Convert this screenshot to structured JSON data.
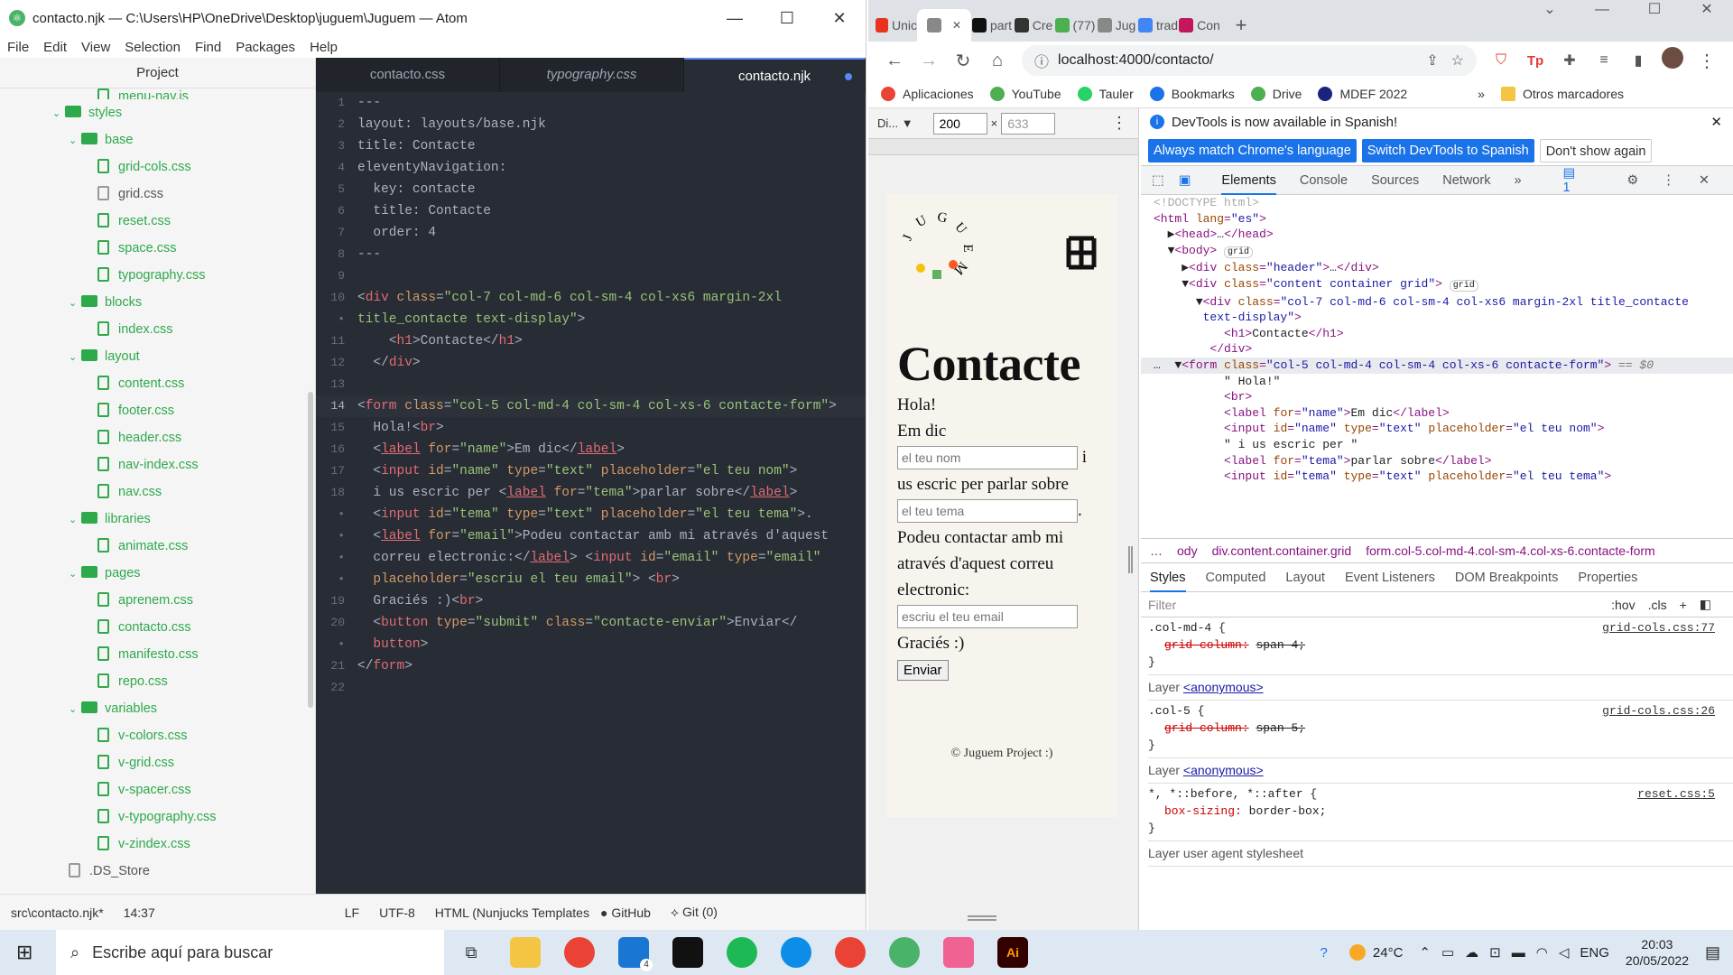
{
  "atom": {
    "title": "contacto.njk — C:\\Users\\HP\\OneDrive\\Desktop\\juguem\\Juguem — Atom",
    "menu": [
      "File",
      "Edit",
      "View",
      "Selection",
      "Find",
      "Packages",
      "Help"
    ],
    "tree_title": "Project",
    "tree": [
      {
        "type": "file",
        "label": "menu-nav.js",
        "depth": 3,
        "cut": true
      },
      {
        "type": "folder",
        "label": "styles",
        "depth": 1
      },
      {
        "type": "folder",
        "label": "base",
        "depth": 2
      },
      {
        "type": "file",
        "label": "grid-cols.css",
        "depth": 3
      },
      {
        "type": "file",
        "label": "grid.css",
        "depth": 3,
        "gray": true
      },
      {
        "type": "file",
        "label": "reset.css",
        "depth": 3
      },
      {
        "type": "file",
        "label": "space.css",
        "depth": 3
      },
      {
        "type": "file",
        "label": "typography.css",
        "depth": 3
      },
      {
        "type": "folder",
        "label": "blocks",
        "depth": 2
      },
      {
        "type": "file",
        "label": "index.css",
        "depth": 3
      },
      {
        "type": "folder",
        "label": "layout",
        "depth": 2
      },
      {
        "type": "file",
        "label": "content.css",
        "depth": 3
      },
      {
        "type": "file",
        "label": "footer.css",
        "depth": 3
      },
      {
        "type": "file",
        "label": "header.css",
        "depth": 3
      },
      {
        "type": "file",
        "label": "nav-index.css",
        "depth": 3
      },
      {
        "type": "file",
        "label": "nav.css",
        "depth": 3
      },
      {
        "type": "folder",
        "label": "libraries",
        "depth": 2
      },
      {
        "type": "file",
        "label": "animate.css",
        "depth": 3
      },
      {
        "type": "folder",
        "label": "pages",
        "depth": 2
      },
      {
        "type": "file",
        "label": "aprenem.css",
        "depth": 3
      },
      {
        "type": "file",
        "label": "contacto.css",
        "depth": 3
      },
      {
        "type": "file",
        "label": "manifesto.css",
        "depth": 3
      },
      {
        "type": "file",
        "label": "repo.css",
        "depth": 3
      },
      {
        "type": "folder",
        "label": "variables",
        "depth": 2
      },
      {
        "type": "file",
        "label": "v-colors.css",
        "depth": 3
      },
      {
        "type": "file",
        "label": "v-grid.css",
        "depth": 3
      },
      {
        "type": "file",
        "label": "v-spacer.css",
        "depth": 3
      },
      {
        "type": "file",
        "label": "v-typography.css",
        "depth": 3
      },
      {
        "type": "file",
        "label": "v-zindex.css",
        "depth": 3
      },
      {
        "type": "file",
        "label": ".DS_Store",
        "depth": 2,
        "gray": true
      }
    ],
    "tabs": [
      {
        "label": "contacto.css"
      },
      {
        "label": "typography.css",
        "italic": true
      },
      {
        "label": "contacto.njk",
        "active": true,
        "modified": true
      }
    ],
    "code": [
      {
        "n": "1",
        "h": "<span class='p'>---</span>"
      },
      {
        "n": "2",
        "h": "<span class='p'>layout: layouts/base.njk</span>"
      },
      {
        "n": "3",
        "h": "<span class='p'>title: Contacte</span>"
      },
      {
        "n": "4",
        "h": "<span class='p'>eleventyNavigation:</span>"
      },
      {
        "n": "5",
        "h": "<span class='p'>  key: contacte</span>"
      },
      {
        "n": "6",
        "h": "<span class='p'>  title: Contacte</span>"
      },
      {
        "n": "7",
        "h": "<span class='p'>  order: 4</span>"
      },
      {
        "n": "8",
        "h": "<span class='p'>---</span>"
      },
      {
        "n": "9",
        "h": ""
      },
      {
        "n": "10",
        "h": "<span class='p'>&lt;</span><span class='t'>div</span> <span class='a'>class</span>=<span class='s'>\"col-7 col-md-6 col-sm-4 col-xs6 margin-2xl</span>"
      },
      {
        "n": "•",
        "h": "<span class='s'>title_contacte text-display\"</span><span class='p'>&gt;</span>"
      },
      {
        "n": "11",
        "h": "    <span class='p'>&lt;</span><span class='t'>h1</span><span class='p'>&gt;Contacte&lt;/</span><span class='t'>h1</span><span class='p'>&gt;</span>"
      },
      {
        "n": "12",
        "h": "  <span class='p'>&lt;/</span><span class='t'>div</span><span class='p'>&gt;</span>"
      },
      {
        "n": "13",
        "h": ""
      },
      {
        "n": "14",
        "h": "<span class='p'>&lt;</span><span class='t'>form</span> <span class='a'>class</span>=<span class='s'>\"col-5 col-md-4 col-sm-4 col-xs-6 contacte-form\"</span><span class='p'>&gt;</span>",
        "cur": true
      },
      {
        "n": "15",
        "h": "  <span class='p'>Hola!&lt;</span><span class='t'>br</span><span class='p'>&gt;</span>"
      },
      {
        "n": "16",
        "h": "  <span class='p'>&lt;</span><span class='t'><u>label</u></span> <span class='a'>for</span>=<span class='s'>\"name\"</span><span class='p'>&gt;Em dic&lt;/</span><span class='t'><u>label</u></span><span class='p'>&gt;</span>"
      },
      {
        "n": "17",
        "h": "  <span class='p'>&lt;</span><span class='t'>input</span> <span class='a'>id</span>=<span class='s'>\"name\"</span> <span class='a'>type</span>=<span class='s'>\"text\"</span> <span class='a'>placeholder</span>=<span class='s'>\"el teu nom\"</span><span class='p'>&gt;</span>"
      },
      {
        "n": "18",
        "h": "  <span class='p'>i us escric per &lt;</span><span class='t'><u>label</u></span> <span class='a'>for</span>=<span class='s'>\"tema\"</span><span class='p'>&gt;parlar sobre&lt;/</span><span class='t'><u>label</u></span><span class='p'>&gt;</span>"
      },
      {
        "n": "•",
        "h": "  <span class='p'>&lt;</span><span class='t'>input</span> <span class='a'>id</span>=<span class='s'>\"tema\"</span> <span class='a'>type</span>=<span class='s'>\"text\"</span> <span class='a'>placeholder</span>=<span class='s'>\"el teu tema\"</span><span class='p'>&gt;.</span>"
      },
      {
        "n": "•",
        "h": "  <span class='p'>&lt;</span><span class='t'><u>label</u></span> <span class='a'>for</span>=<span class='s'>\"email\"</span><span class='p'>&gt;Podeu contactar amb mi através d'aquest</span>"
      },
      {
        "n": "•",
        "h": "  <span class='p'>correu electronic:&lt;/</span><span class='t'><u>label</u></span><span class='p'>&gt; &lt;</span><span class='t'>input</span> <span class='a'>id</span>=<span class='s'>\"email\"</span> <span class='a'>type</span>=<span class='s'>\"email\"</span>"
      },
      {
        "n": "•",
        "h": "  <span class='a'>placeholder</span>=<span class='s'>\"escriu el teu email\"</span><span class='p'>&gt; &lt;</span><span class='t'>br</span><span class='p'>&gt;</span>"
      },
      {
        "n": "19",
        "h": "  <span class='p'>Graciés :)&lt;</span><span class='t'>br</span><span class='p'>&gt;</span>"
      },
      {
        "n": "20",
        "h": "  <span class='p'>&lt;</span><span class='t'>button</span> <span class='a'>type</span>=<span class='s'>\"submit\"</span> <span class='a'>class</span>=<span class='s'>\"contacte-enviar\"</span><span class='p'>&gt;Enviar&lt;/</span>"
      },
      {
        "n": "•",
        "h": "  <span class='t'>button</span><span class='p'>&gt;</span>"
      },
      {
        "n": "21",
        "h": "<span class='p'>&lt;/</span><span class='t'>form</span><span class='p'>&gt;</span>"
      },
      {
        "n": "22",
        "h": ""
      }
    ],
    "status": {
      "path": "src\\contacto.njk*",
      "pos": "14:37",
      "eol": "LF",
      "enc": "UTF-8",
      "grammar": "HTML (Nunjucks Templates",
      "github": "GitHub",
      "git": "Git (0)"
    }
  },
  "chrome": {
    "tabs": [
      {
        "label": "Unic",
        "color": "#e8331f"
      },
      {
        "label": "",
        "color": "#888",
        "active": true
      },
      {
        "label": "part",
        "color": "#111"
      },
      {
        "label": "Cre",
        "color": "#333"
      },
      {
        "label": "(77)",
        "color": "#4caf50"
      },
      {
        "label": "Jug",
        "color": "#888"
      },
      {
        "label": "trad",
        "color": "#4285f4"
      },
      {
        "label": "Con",
        "color": "#c2185b"
      }
    ],
    "url": "localhost:4000/contacto/",
    "bookmarks": [
      {
        "label": "Aplicaciones",
        "color": "#ea4335"
      },
      {
        "label": "YouTube",
        "color": "#4caf50"
      },
      {
        "label": "Tauler",
        "color": "#25d366"
      },
      {
        "label": "Bookmarks",
        "color": "#1a73e8"
      },
      {
        "label": "Drive",
        "color": "#4caf50"
      },
      {
        "label": "MDEF 2022",
        "color": "#1a237e"
      }
    ],
    "other_bookmarks": "Otros marcadores",
    "device": {
      "label": "Di...",
      "width": "200",
      "height": "633"
    },
    "page": {
      "logo_text": "JUGUEM",
      "title": "Contacte",
      "hola": "Hola!",
      "emdic": "Em dic",
      "name_ph": "el teu nom",
      "i": "i",
      "us_escric": "us escric per parlar sobre",
      "tema_ph": "el teu tema",
      "period": ".",
      "contact_text": "Podeu contactar amb mi através d'aquest correu electronic:",
      "email_ph": "escriu el teu email",
      "gracies": "Graciés :)",
      "send": "Enviar",
      "footer": "© Juguem Project :)"
    },
    "devtools": {
      "notice": "DevTools is now available in Spanish!",
      "btn1": "Always match Chrome's language",
      "btn2": "Switch DevTools to Spanish",
      "btn3": "Don't show again",
      "tabs": [
        "Elements",
        "Console",
        "Sources",
        "Network"
      ],
      "badge": "1",
      "dom": [
        "<span class='cm'>&lt;!DOCTYPE html&gt;</span>",
        "<span class='tg'>&lt;html</span> <span class='at'>lang</span>=<span class='av'>\"es\"</span><span class='tg'>&gt;</span>",
        "  <span class='tx2'>▶</span><span class='tg'>&lt;head&gt;</span><span class='tx2'>…</span><span class='tg'>&lt;/head&gt;</span>",
        "  <span class='tx2'>▼</span><span class='tg'>&lt;body&gt;</span> <span class='tx2' style='font-size:10px;border:1px solid #ccc;border-radius:6px;padding:0 3px'>grid</span>",
        "    <span class='tx2'>▶</span><span class='tg'>&lt;div</span> <span class='at'>class</span>=<span class='av'>\"header\"</span><span class='tg'>&gt;</span><span class='tx2'>…</span><span class='tg'>&lt;/div&gt;</span>",
        "    <span class='tx2'>▼</span><span class='tg'>&lt;div</span> <span class='at'>class</span>=<span class='av'>\"content container grid\"</span><span class='tg'>&gt;</span> <span class='tx2' style='font-size:10px;border:1px solid #ccc;border-radius:6px;padding:0 3px'>grid</span>",
        "      <span class='tx2'>▼</span><span class='tg'>&lt;div</span> <span class='at'>class</span>=<span class='av'>\"col-7 col-md-6 col-sm-4 col-xs6 margin-2xl title_contacte</span>",
        "       <span class='av'>text-display\"</span><span class='tg'>&gt;</span>",
        "          <span class='tg'>&lt;h1&gt;</span><span class='tx2'>Contacte</span><span class='tg'>&lt;/h1&gt;</span>",
        "        <span class='tg'>&lt;/div&gt;</span>",
        "SEL",
        "          <span class='tx2'>\" Hola!\"</span>",
        "          <span class='tg'>&lt;br&gt;</span>",
        "          <span class='tg'>&lt;label</span> <span class='at'>for</span>=<span class='av'>\"name\"</span><span class='tg'>&gt;</span><span class='tx2'>Em dic</span><span class='tg'>&lt;/label&gt;</span>",
        "          <span class='tg'>&lt;input</span> <span class='at'>id</span>=<span class='av'>\"name\"</span> <span class='at'>type</span>=<span class='av'>\"text\"</span> <span class='at'>placeholder</span>=<span class='av'>\"el teu nom\"</span><span class='tg'>&gt;</span>",
        "          <span class='tx2'>\" i us escric per \"</span>",
        "          <span class='tg'>&lt;label</span> <span class='at'>for</span>=<span class='av'>\"tema\"</span><span class='tg'>&gt;</span><span class='tx2'>parlar sobre</span><span class='tg'>&lt;/label&gt;</span>",
        "          <span class='tg'>&lt;input</span> <span class='at'>id</span>=<span class='av'>\"tema\"</span> <span class='at'>type</span>=<span class='av'>\"text\"</span> <span class='at'>placeholder</span>=<span class='av'>\"el teu tema\"</span><span class='tg'>&gt;</span>"
      ],
      "selected_row": "<span class='tx2'>…</span>  <span class='tx2'>▼</span><span class='tg'>&lt;form</span> <span class='at'>class</span>=<span class='av'>\"col-5 col-md-4 col-sm-4 col-xs-6 contacte-form\"</span><span class='tg'>&gt;</span> <span class='tx2' style='font-style:italic;color:#777'>== $0</span>",
      "breadcrumb": [
        "…",
        "ody",
        "div.content.container.grid",
        "form.col-5.col-md-4.col-sm-4.col-xs-6.contacte-form"
      ],
      "style_tabs": [
        "Styles",
        "Computed",
        "Layout",
        "Event Listeners",
        "DOM Breakpoints",
        "Properties"
      ],
      "filter": "Filter",
      "hov": ":hov",
      "cls": ".cls",
      "rules": [
        {
          "sel": ".col-md-4 {",
          "prop": "grid-column:",
          "val": "span 4;",
          "src": "grid-cols.css:77",
          "strike": true
        },
        {
          "layer": "Layer",
          "anon": "<anonymous>"
        },
        {
          "sel": ".col-5 {",
          "prop": "grid-column:",
          "val": "span 5;",
          "src": "grid-cols.css:26",
          "strike": true
        },
        {
          "layer": "Layer",
          "anon": "<anonymous>"
        },
        {
          "sel": "*, *::before, *::after {",
          "prop": "box-sizing:",
          "val": "border-box;",
          "src": "reset.css:5",
          "strike": false
        },
        {
          "layer": "Layer user agent stylesheet",
          "anon": ""
        }
      ]
    }
  },
  "taskbar": {
    "search": "Escribe aquí para buscar",
    "temp": "24°C",
    "lang": "ENG",
    "time": "20:03",
    "date": "20/05/2022",
    "notif": "4"
  }
}
